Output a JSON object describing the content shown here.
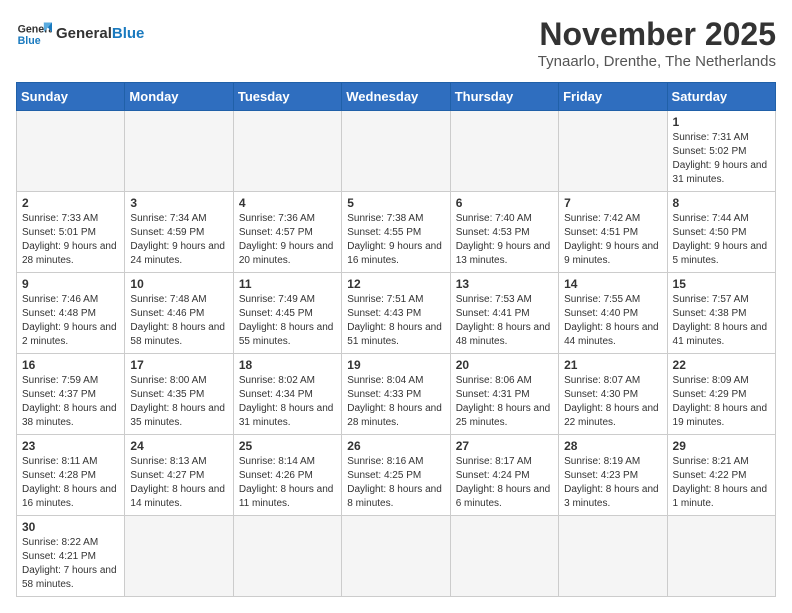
{
  "header": {
    "logo_general": "General",
    "logo_blue": "Blue",
    "month_year": "November 2025",
    "location": "Tynaarlo, Drenthe, The Netherlands"
  },
  "days_of_week": [
    "Sunday",
    "Monday",
    "Tuesday",
    "Wednesday",
    "Thursday",
    "Friday",
    "Saturday"
  ],
  "weeks": [
    [
      {
        "day": "",
        "info": ""
      },
      {
        "day": "",
        "info": ""
      },
      {
        "day": "",
        "info": ""
      },
      {
        "day": "",
        "info": ""
      },
      {
        "day": "",
        "info": ""
      },
      {
        "day": "",
        "info": ""
      },
      {
        "day": "1",
        "info": "Sunrise: 7:31 AM\nSunset: 5:02 PM\nDaylight: 9 hours and 31 minutes."
      }
    ],
    [
      {
        "day": "2",
        "info": "Sunrise: 7:33 AM\nSunset: 5:01 PM\nDaylight: 9 hours and 28 minutes."
      },
      {
        "day": "3",
        "info": "Sunrise: 7:34 AM\nSunset: 4:59 PM\nDaylight: 9 hours and 24 minutes."
      },
      {
        "day": "4",
        "info": "Sunrise: 7:36 AM\nSunset: 4:57 PM\nDaylight: 9 hours and 20 minutes."
      },
      {
        "day": "5",
        "info": "Sunrise: 7:38 AM\nSunset: 4:55 PM\nDaylight: 9 hours and 16 minutes."
      },
      {
        "day": "6",
        "info": "Sunrise: 7:40 AM\nSunset: 4:53 PM\nDaylight: 9 hours and 13 minutes."
      },
      {
        "day": "7",
        "info": "Sunrise: 7:42 AM\nSunset: 4:51 PM\nDaylight: 9 hours and 9 minutes."
      },
      {
        "day": "8",
        "info": "Sunrise: 7:44 AM\nSunset: 4:50 PM\nDaylight: 9 hours and 5 minutes."
      }
    ],
    [
      {
        "day": "9",
        "info": "Sunrise: 7:46 AM\nSunset: 4:48 PM\nDaylight: 9 hours and 2 minutes."
      },
      {
        "day": "10",
        "info": "Sunrise: 7:48 AM\nSunset: 4:46 PM\nDaylight: 8 hours and 58 minutes."
      },
      {
        "day": "11",
        "info": "Sunrise: 7:49 AM\nSunset: 4:45 PM\nDaylight: 8 hours and 55 minutes."
      },
      {
        "day": "12",
        "info": "Sunrise: 7:51 AM\nSunset: 4:43 PM\nDaylight: 8 hours and 51 minutes."
      },
      {
        "day": "13",
        "info": "Sunrise: 7:53 AM\nSunset: 4:41 PM\nDaylight: 8 hours and 48 minutes."
      },
      {
        "day": "14",
        "info": "Sunrise: 7:55 AM\nSunset: 4:40 PM\nDaylight: 8 hours and 44 minutes."
      },
      {
        "day": "15",
        "info": "Sunrise: 7:57 AM\nSunset: 4:38 PM\nDaylight: 8 hours and 41 minutes."
      }
    ],
    [
      {
        "day": "16",
        "info": "Sunrise: 7:59 AM\nSunset: 4:37 PM\nDaylight: 8 hours and 38 minutes."
      },
      {
        "day": "17",
        "info": "Sunrise: 8:00 AM\nSunset: 4:35 PM\nDaylight: 8 hours and 35 minutes."
      },
      {
        "day": "18",
        "info": "Sunrise: 8:02 AM\nSunset: 4:34 PM\nDaylight: 8 hours and 31 minutes."
      },
      {
        "day": "19",
        "info": "Sunrise: 8:04 AM\nSunset: 4:33 PM\nDaylight: 8 hours and 28 minutes."
      },
      {
        "day": "20",
        "info": "Sunrise: 8:06 AM\nSunset: 4:31 PM\nDaylight: 8 hours and 25 minutes."
      },
      {
        "day": "21",
        "info": "Sunrise: 8:07 AM\nSunset: 4:30 PM\nDaylight: 8 hours and 22 minutes."
      },
      {
        "day": "22",
        "info": "Sunrise: 8:09 AM\nSunset: 4:29 PM\nDaylight: 8 hours and 19 minutes."
      }
    ],
    [
      {
        "day": "23",
        "info": "Sunrise: 8:11 AM\nSunset: 4:28 PM\nDaylight: 8 hours and 16 minutes."
      },
      {
        "day": "24",
        "info": "Sunrise: 8:13 AM\nSunset: 4:27 PM\nDaylight: 8 hours and 14 minutes."
      },
      {
        "day": "25",
        "info": "Sunrise: 8:14 AM\nSunset: 4:26 PM\nDaylight: 8 hours and 11 minutes."
      },
      {
        "day": "26",
        "info": "Sunrise: 8:16 AM\nSunset: 4:25 PM\nDaylight: 8 hours and 8 minutes."
      },
      {
        "day": "27",
        "info": "Sunrise: 8:17 AM\nSunset: 4:24 PM\nDaylight: 8 hours and 6 minutes."
      },
      {
        "day": "28",
        "info": "Sunrise: 8:19 AM\nSunset: 4:23 PM\nDaylight: 8 hours and 3 minutes."
      },
      {
        "day": "29",
        "info": "Sunrise: 8:21 AM\nSunset: 4:22 PM\nDaylight: 8 hours and 1 minute."
      }
    ],
    [
      {
        "day": "30",
        "info": "Sunrise: 8:22 AM\nSunset: 4:21 PM\nDaylight: 7 hours and 58 minutes."
      },
      {
        "day": "",
        "info": ""
      },
      {
        "day": "",
        "info": ""
      },
      {
        "day": "",
        "info": ""
      },
      {
        "day": "",
        "info": ""
      },
      {
        "day": "",
        "info": ""
      },
      {
        "day": "",
        "info": ""
      }
    ]
  ]
}
